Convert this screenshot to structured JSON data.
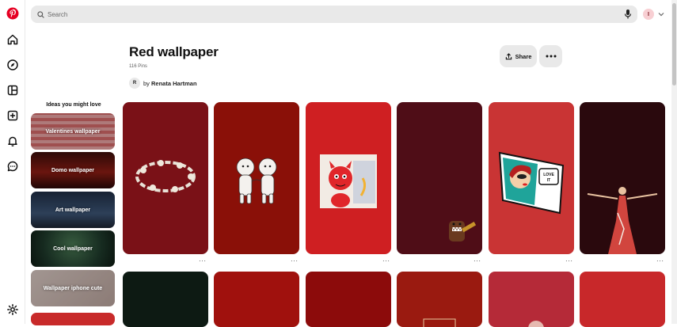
{
  "rail": {
    "icons": [
      "pinterest-logo",
      "home-icon",
      "explore-icon",
      "boards-icon",
      "create-icon",
      "notifications-icon",
      "messages-icon",
      "settings-icon"
    ]
  },
  "search": {
    "placeholder": "Search"
  },
  "user": {
    "avatar_letter": "I"
  },
  "board": {
    "title": "Red wallpaper",
    "pin_count": "116 Pins",
    "owner_initial": "R",
    "by_label": "by",
    "owner_name": "Renata Hartman",
    "share_label": "Share"
  },
  "ideas": {
    "heading": "Ideas you might love",
    "items": [
      {
        "label": "Valentines wallpaper",
        "color": "#d46a6a"
      },
      {
        "label": "Domo wallpaper",
        "color": "#5b1410"
      },
      {
        "label": "Art wallpaper",
        "color": "#2c3d57"
      },
      {
        "label": "Cool wallpaper",
        "color": "#1f3b2c"
      },
      {
        "label": "Wallpaper iphone cute",
        "color": "#c9b6b0"
      }
    ]
  },
  "pins": [
    {
      "subject": "angel-ring",
      "color": "#7a1117",
      "more_label": "···"
    },
    {
      "subject": "kewpie-dolls",
      "color": "#8a1008",
      "more_label": "···"
    },
    {
      "subject": "hot-stuff-devil",
      "color": "#cf1f22",
      "more_label": "···"
    },
    {
      "subject": "domo-guitar",
      "color": "#4f0d17",
      "more_label": "···"
    },
    {
      "subject": "pop-art-woman",
      "color": "#c93434",
      "more_label": "···",
      "speech_text": "LOVE IT"
    },
    {
      "subject": "dancer-figure",
      "color": "#2a090d",
      "more_label": "···"
    },
    {
      "subject": "dark-green",
      "color": "#0d1a13"
    },
    {
      "subject": "plain-red",
      "color": "#a0110d"
    },
    {
      "subject": "plain-red-2",
      "color": "#8c0b0b"
    },
    {
      "subject": "red-frame",
      "color": "#9a1a10"
    },
    {
      "subject": "rose-red",
      "color": "#b52a38"
    },
    {
      "subject": "bright-red",
      "color": "#c8282a"
    }
  ]
}
